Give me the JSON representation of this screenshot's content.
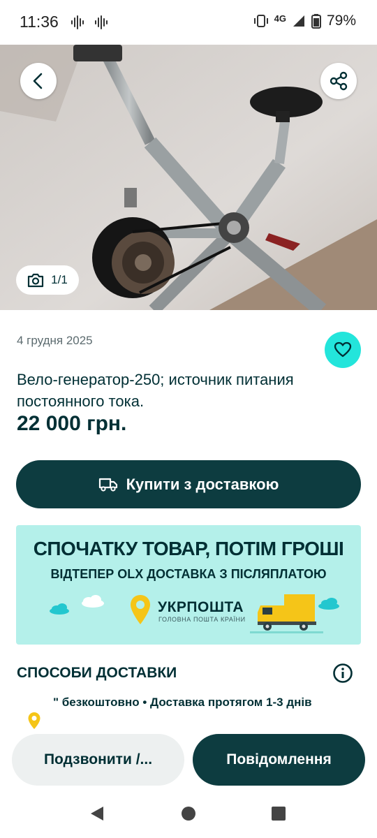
{
  "status_bar": {
    "time": "11:36",
    "network": "4G",
    "battery": "79%"
  },
  "gallery": {
    "photo_counter": "1/1"
  },
  "listing": {
    "date": "4 грудня 2025",
    "title": "Вело-генератор-250; источник питания постоянного тока.",
    "price": "22 000 грн."
  },
  "buy_button": {
    "label": "Купити з доставкою"
  },
  "promo_banner": {
    "headline": "СПОЧАТКУ ТОВАР, ПОТІМ ГРОШІ",
    "subheadline": "ВІДТЕПЕР OLX ДОСТАВКА З ПІСЛЯПЛАТОЮ",
    "brand": "УКРПОШТА",
    "tagline": "ГОЛОВНА ПОШТА КРАЇНИ"
  },
  "delivery": {
    "heading": "СПОСОБИ ДОСТАВКИ",
    "details": "\" безкоштовно • Доставка протягом 1-3 днів"
  },
  "actions": {
    "call_label": "Подзвонити /...",
    "message_label": "Повідомлення"
  },
  "colors": {
    "primary_dark": "#0d3c40",
    "accent_teal": "#23e5db",
    "promo_bg": "#b4f0ea",
    "text_dark": "#002f34",
    "ukrposhta_yellow": "#f5c518"
  }
}
